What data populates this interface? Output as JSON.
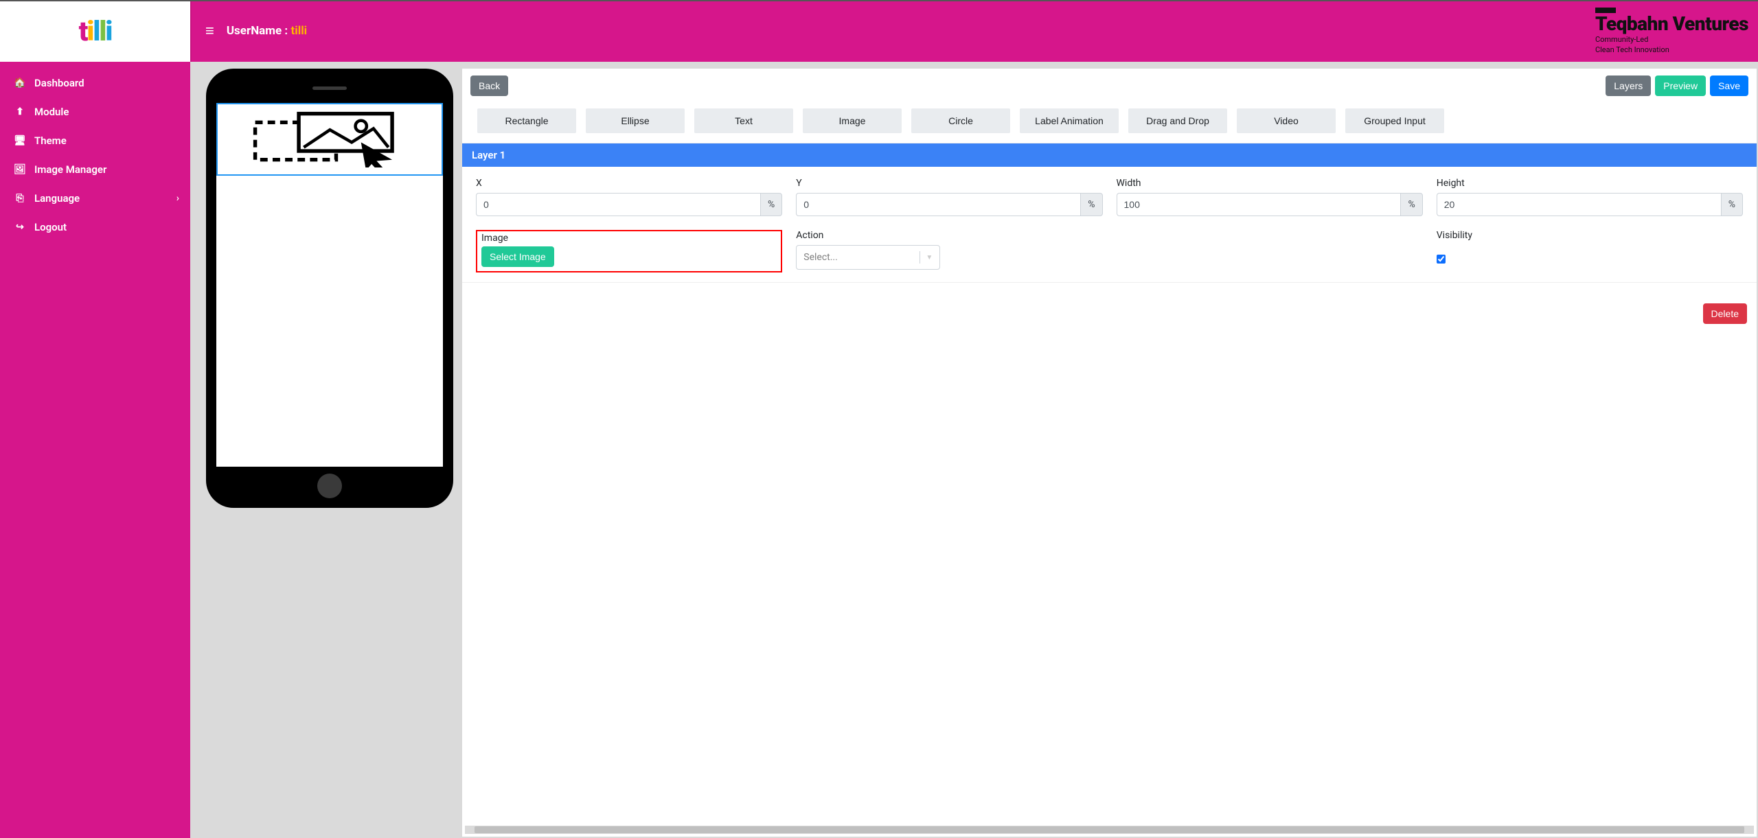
{
  "header": {
    "username_label": "UserName : ",
    "username_value": "tilli",
    "brand_name": "Teqbahn Ventures",
    "brand_sub1": "Community-Led",
    "brand_sub2": "Clean Tech Innovation"
  },
  "logo": {
    "t1": "t",
    "t2": "i",
    "t3": "l",
    "t4": "l",
    "t5": "i"
  },
  "sidebar": {
    "items": [
      {
        "icon": "home-icon",
        "glyph": "🏠",
        "label": "Dashboard"
      },
      {
        "icon": "upload-icon",
        "glyph": "⬆",
        "label": "Module"
      },
      {
        "icon": "monitor-icon",
        "glyph": "🖥",
        "label": "Theme"
      },
      {
        "icon": "image-icon",
        "glyph": "🖼",
        "label": "Image Manager"
      },
      {
        "icon": "language-icon",
        "glyph": "⎘",
        "label": "Language",
        "has_submenu": true
      },
      {
        "icon": "logout-icon",
        "glyph": "↪",
        "label": "Logout"
      }
    ]
  },
  "toolbar": {
    "back": "Back",
    "layers": "Layers",
    "preview": "Preview",
    "save": "Save"
  },
  "shapes": [
    "Rectangle",
    "Ellipse",
    "Text",
    "Image",
    "Circle",
    "Label Animation",
    "Drag and Drop",
    "Video",
    "Grouped Input"
  ],
  "layer": {
    "title": "Layer 1",
    "x_label": "X",
    "x_value": "0",
    "x_unit": "%",
    "y_label": "Y",
    "y_value": "0",
    "y_unit": "%",
    "w_label": "Width",
    "w_value": "100",
    "w_unit": "%",
    "h_label": "Height",
    "h_value": "20",
    "h_unit": "%",
    "image_label": "Image",
    "select_image": "Select Image",
    "action_label": "Action",
    "action_placeholder": "Select...",
    "visibility_label": "Visibility",
    "delete": "Delete"
  }
}
